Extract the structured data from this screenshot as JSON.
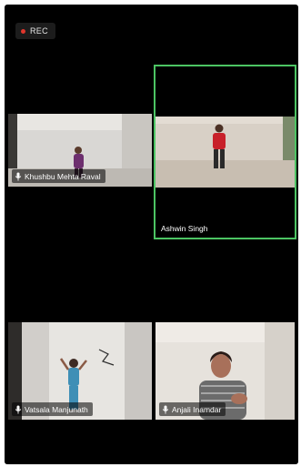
{
  "recording": {
    "label": "REC",
    "indicator_color": "#e0362c"
  },
  "participants": [
    {
      "name": "Khushbu Mehta Raval"
    },
    {
      "name": "Ashwin Singh",
      "active_speaker": true,
      "highlight_color": "#4cc463"
    },
    {
      "name": "Vatsala Manjunath"
    },
    {
      "name": "Anjali Inamdar"
    }
  ],
  "icons": {
    "mic": "microphone-icon",
    "record": "record-dot-icon"
  }
}
